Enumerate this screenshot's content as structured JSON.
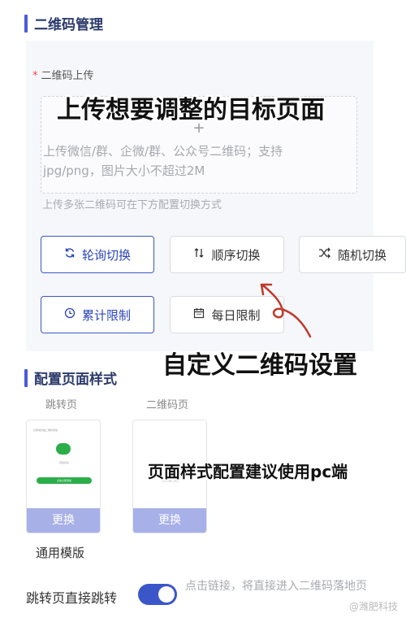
{
  "qr_section": {
    "title": "二维码管理",
    "upload_label": "二维码上传",
    "required_mark": "*",
    "plus": "+",
    "upload_desc": "上传微信/群、企微/群、公众号二维码；支持jpg/png，图片大小不超过2M",
    "hint": "上传多张二维码可在下方配置切换方式",
    "options": [
      {
        "label": "轮询切换",
        "icon": "refresh-icon",
        "selected": true
      },
      {
        "label": "顺序切换",
        "icon": "sort-arrows-icon",
        "selected": false
      },
      {
        "label": "随机切换",
        "icon": "shuffle-icon",
        "selected": false
      },
      {
        "label": "累计限制",
        "icon": "clock-icon",
        "selected": true
      },
      {
        "label": "每日限制",
        "icon": "calendar-icon",
        "selected": false
      }
    ]
  },
  "overlays": {
    "top_caption": "上传想要调整的目标页面",
    "middle_caption": "自定义二维码设置",
    "bottom_caption": "页面样式配置建议使用pc端"
  },
  "style_section": {
    "title": "配置页面样式",
    "columns": [
      {
        "label": "跳转页",
        "button": "更换"
      },
      {
        "label": "二维码页",
        "button": "更换"
      }
    ],
    "preview_text": {
      "line1": "长按或扫描二维码添加",
      "line2": "添加好友",
      "line3": "点击立即添加",
      "qr_text": "长按识别二维码"
    },
    "template_name": "通用模版"
  },
  "redirect": {
    "label": "跳转页直接跳转",
    "enabled": true,
    "desc": "点击链接，将直接进入二维码落地页"
  },
  "watermark": "@潍肥科技",
  "colors": {
    "accent": "#3b56c8",
    "replace_bar": "#a8b0e8",
    "wechat_green": "#2bad4a",
    "arrow_red": "#c0392b"
  }
}
